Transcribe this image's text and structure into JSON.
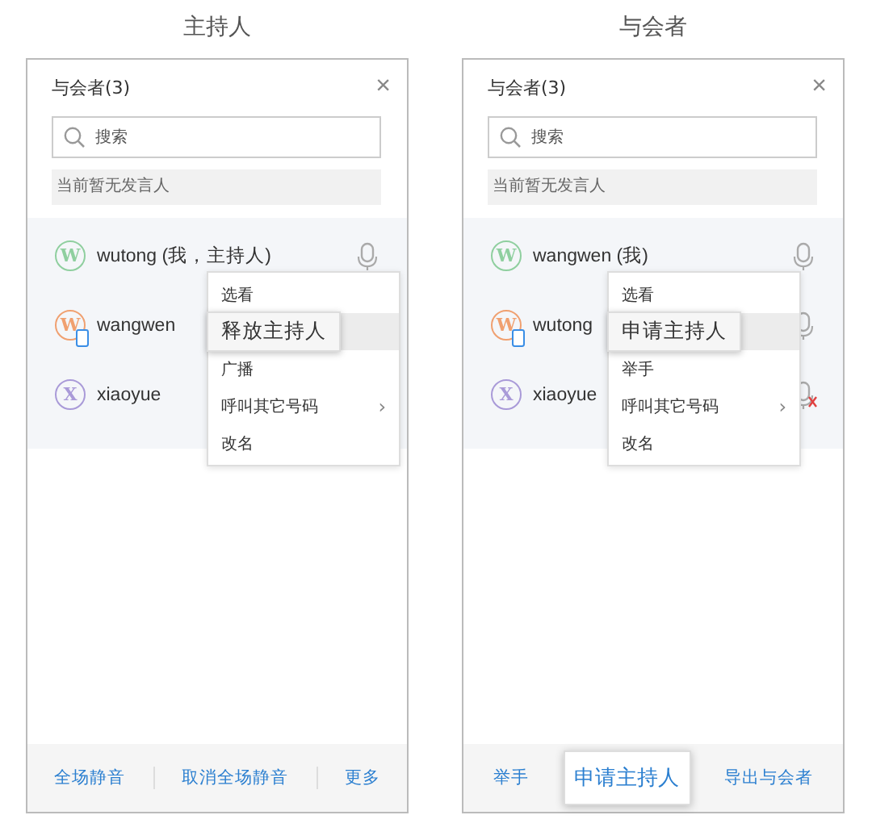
{
  "panels": [
    {
      "caption": "主持人",
      "title": "与会者(3)",
      "close": "×",
      "search": {
        "placeholder": "搜索"
      },
      "speaker_notice": "当前暂无发言人",
      "participants": [
        {
          "initial": "W",
          "color": "#8fcf9f",
          "name": "wutong (我，主持人)",
          "mobile": false,
          "mic_muted": false
        },
        {
          "initial": "W",
          "color": "#f0a070",
          "name": "wangwen",
          "mobile": true
        },
        {
          "initial": "X",
          "color": "#a99ad8",
          "name": "xiaoyue",
          "mobile": false
        }
      ],
      "menu": [
        {
          "label": "选看",
          "selected": false
        },
        {
          "label": "释放主持人",
          "selected": true
        },
        {
          "label": "广播",
          "selected": false
        },
        {
          "label": "呼叫其它号码",
          "submenu": "›",
          "selected": false
        },
        {
          "label": "改名",
          "selected": false
        }
      ],
      "footer": [
        {
          "label": "全场静音",
          "selected": false
        },
        {
          "label": "取消全场静音",
          "selected": false
        },
        {
          "label": "更多",
          "selected": false
        }
      ]
    },
    {
      "caption": "与会者",
      "title": "与会者(3)",
      "close": "×",
      "search": {
        "placeholder": "搜索"
      },
      "speaker_notice": "当前暂无发言人",
      "participants": [
        {
          "initial": "W",
          "color": "#8fcf9f",
          "name": "wangwen (我)",
          "mobile": false,
          "mic_muted": false
        },
        {
          "initial": "W",
          "color": "#f0a070",
          "name": "wutong",
          "mobile": true,
          "mic_muted": false
        },
        {
          "initial": "X",
          "color": "#a99ad8",
          "name": "xiaoyue",
          "mobile": false,
          "mic_muted": true
        }
      ],
      "menu": [
        {
          "label": "选看",
          "selected": false
        },
        {
          "label": "申请主持人",
          "selected": true
        },
        {
          "label": "举手",
          "selected": false
        },
        {
          "label": "呼叫其它号码",
          "submenu": "›",
          "selected": false
        },
        {
          "label": "改名",
          "selected": false
        }
      ],
      "footer": [
        {
          "label": "举手",
          "selected": false
        },
        {
          "label": "申请主持人",
          "selected": true
        },
        {
          "label": "导出与会者",
          "selected": false
        }
      ]
    }
  ]
}
